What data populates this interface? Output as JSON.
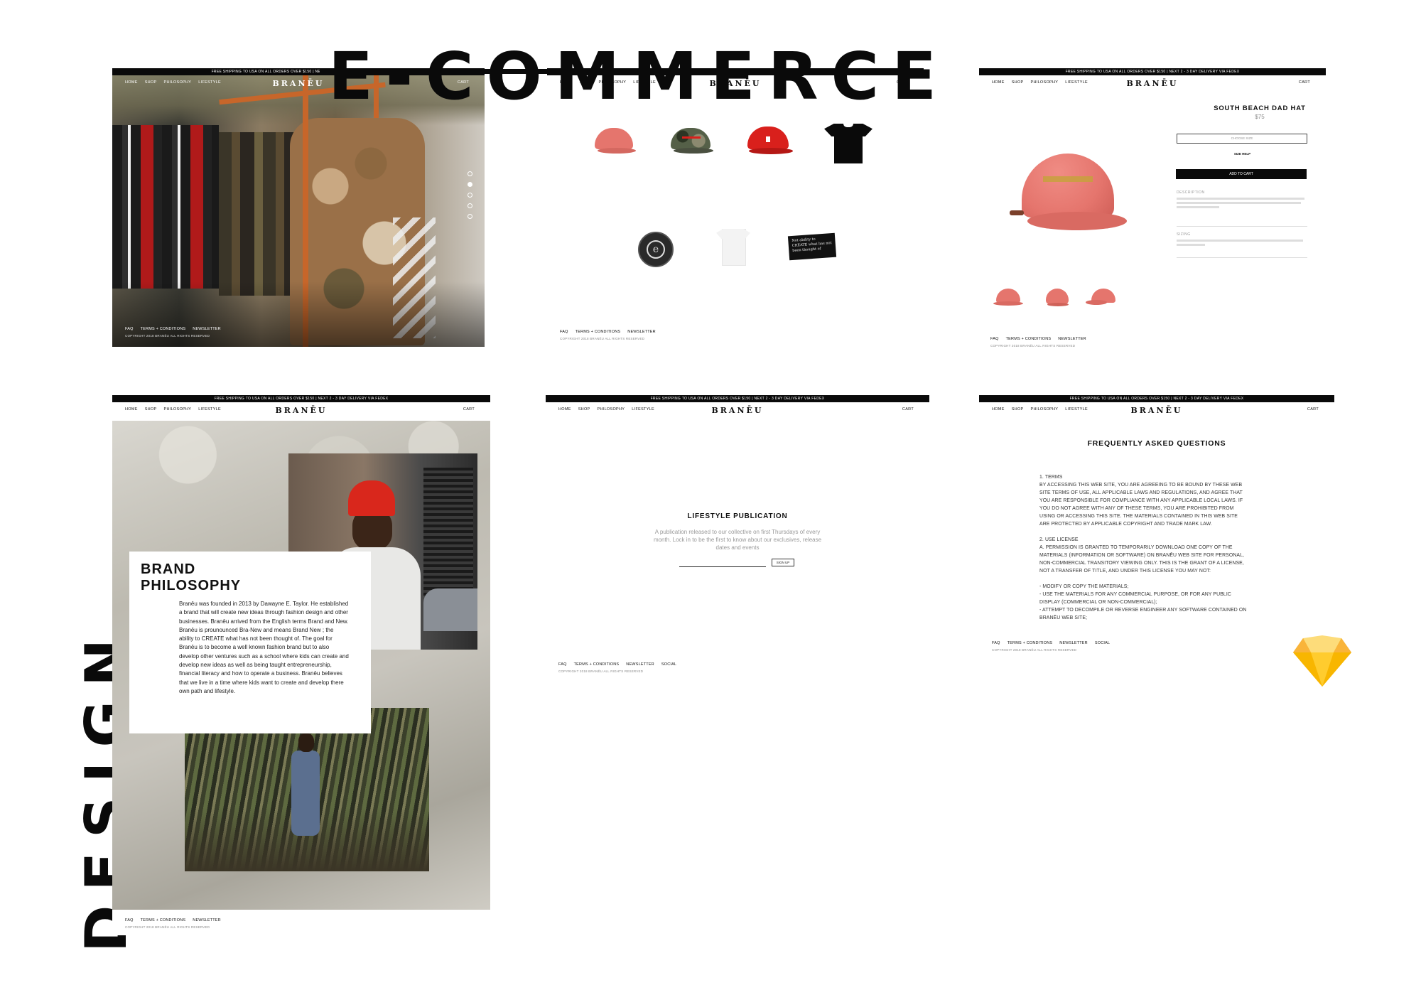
{
  "titles": {
    "main": "E-COMMERCE",
    "side": "DESIGN"
  },
  "shared": {
    "topbar": "FREE SHIPPING TO USA ON ALL ORDERS OVER $150 | NEXT 2 - 3 DAY DELIVERY VIA FEDEX",
    "nav_links": [
      "HOME",
      "SHOP",
      "PHILOSOPHY",
      "LIFESTYLE"
    ],
    "logo": "BRANĒU",
    "cart": "CART",
    "footer_links_3": [
      "FAQ",
      "TERMS + CONDITIONS",
      "NEWSLETTER"
    ],
    "footer_links_4": [
      "FAQ",
      "TERMS + CONDITIONS",
      "NEWSLETTER",
      "SOCIAL"
    ],
    "copyright": "COPYRIGHT 2018 BRANĒU ALL RIGHTS RESERVED"
  },
  "shop": {
    "patch_text": "Not ability to CREATE what has not been thought of"
  },
  "product": {
    "title": "SOUTH BEACH DAD HAT",
    "price": "$75",
    "size_select_placeholder": "CHOOSE SIZE",
    "size_help": "SIZE HELP",
    "add_to_cart": "ADD TO CART",
    "description_label": "DESCRIPTION",
    "sizing_label": "SIZING"
  },
  "philosophy": {
    "heading_line1": "BRAND",
    "heading_line2": "PHILOSOPHY",
    "body": "Branēu was founded in 2013 by Dawayne E. Taylor. He established a brand that will create new ideas through fashion design and other businesses. Branēu arrived from the English terms Brand and New. Branēu is prounounced Bra-New and means Brand New ; the ability to CREATE what has not been thought of. The goal for Branēu is to become a well known fashion brand but to also develop other ventures such as a school where kids can create and develop new ideas as well as being taught entrepreneurship, financial literacy and how to operate a business. Branēu believes that we live in a time where kids want to create and develop there own path and lifestyle."
  },
  "lifestyle": {
    "heading": "LIFESTYLE PUBLICATION",
    "body": "A publication released to our collective on first Thursdays of every month. Lock in to be the first to know about our exclusives, release dates and events",
    "signup": "SIGN UP"
  },
  "faq": {
    "heading": "FREQUENTLY ASKED QUESTIONS",
    "lines": [
      "1. TERMS",
      "BY ACCESSING THIS WEB SITE, YOU ARE AGREEING TO BE BOUND BY THESE WEB",
      "SITE TERMS OF USE, ALL APPLICABLE LAWS AND REGULATIONS, AND AGREE THAT",
      "YOU ARE RESPONSIBLE FOR COMPLIANCE WITH ANY APPLICABLE LOCAL LAWS. IF",
      "YOU DO NOT AGREE WITH ANY OF THESE TERMS, YOU ARE PROHIBITED FROM",
      "USING OR ACCESSING THIS SITE. THE MATERIALS CONTAINED IN THIS WEB SITE",
      "ARE PROTECTED BY APPLICABLE COPYRIGHT AND TRADE MARK LAW.",
      "",
      "2. USE LICENSE",
      "A. PERMISSION IS GRANTED TO TEMPORARILY DOWNLOAD ONE COPY OF THE",
      "MATERIALS (INFORMATION OR SOFTWARE) ON BRANĒU WEB SITE FOR PERSONAL,",
      "NON-COMMERCIAL TRANSITORY VIEWING ONLY. THIS IS THE GRANT OF A LICENSE,",
      "NOT A TRANSFER OF TITLE, AND UNDER THIS LICENSE YOU MAY NOT:",
      "",
      "- MODIFY OR COPY THE MATERIALS;",
      "- USE THE MATERIALS FOR ANY COMMERCIAL PURPOSE, OR FOR ANY PUBLIC",
      "DISPLAY (COMMERCIAL OR NON-COMMERCIAL);",
      "- ATTEMPT TO DECOMPILE OR REVERSE ENGINEER ANY SOFTWARE CONTAINED ON",
      "BRANĒU WEB SITE;"
    ]
  },
  "colors": {
    "black": "#0a0a0a",
    "hat_pink": "#e5756d",
    "hat_red": "#d9201c",
    "sketch_orange": "#f7a800"
  },
  "icons": {
    "sketch": "sketch-diamond-icon"
  }
}
